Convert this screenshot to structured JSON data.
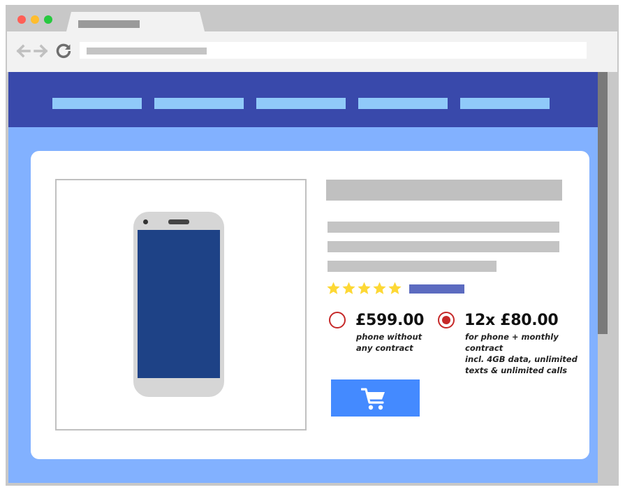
{
  "browser": {
    "controls": {
      "close_color": "#ff5f56",
      "minimize_color": "#ffbd2e",
      "maximize_color": "#27c93f"
    },
    "nav_icons": [
      "back-arrow-icon",
      "forward-arrow-icon",
      "reload-icon"
    ]
  },
  "colors": {
    "navbar": "#3949ab",
    "nav_item": "#90caf9",
    "page_background": "#82b1ff",
    "phone_screen": "#1e4286",
    "star": "#fdd835",
    "radio_accent": "#c62828",
    "cart_button": "#448aff",
    "review_link": "#5c6bc0"
  },
  "product": {
    "rating": {
      "value": 5,
      "max": 5
    },
    "options": [
      {
        "price": "£599.00",
        "note_lines": [
          "phone without",
          "any contract"
        ],
        "selected": false
      },
      {
        "price": "12x £80.00",
        "note_lines": [
          "for phone + monthly contract",
          "incl. 4GB data, unlimited",
          "texts & unlimited calls"
        ],
        "selected": true
      }
    ],
    "cart_icon": "shopping-cart-icon"
  }
}
